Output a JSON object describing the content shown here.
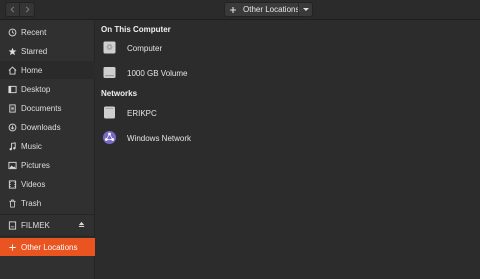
{
  "header": {
    "back_icon": "chevron-left-icon",
    "forward_icon": "chevron-right-icon",
    "path_label": "Other Locations",
    "path_icon": "plus-icon",
    "menu_icon": "caret-down-icon"
  },
  "sidebar": {
    "items": [
      {
        "label": "Recent",
        "icon": "clock-icon"
      },
      {
        "label": "Starred",
        "icon": "star-icon"
      },
      {
        "label": "Home",
        "icon": "home-icon"
      },
      {
        "label": "Desktop",
        "icon": "desktop-icon"
      },
      {
        "label": "Documents",
        "icon": "document-icon"
      },
      {
        "label": "Downloads",
        "icon": "download-icon"
      },
      {
        "label": "Music",
        "icon": "music-icon"
      },
      {
        "label": "Pictures",
        "icon": "picture-icon"
      },
      {
        "label": "Videos",
        "icon": "video-icon"
      },
      {
        "label": "Trash",
        "icon": "trash-icon"
      }
    ],
    "device": {
      "label": "FILMEK",
      "icon": "drive-icon",
      "eject_icon": "eject-icon"
    },
    "other_locations": {
      "label": "Other Locations",
      "icon": "plus-icon"
    },
    "accent_color": "#e95420"
  },
  "main": {
    "on_this_computer": {
      "title": "On This Computer",
      "items": [
        {
          "label": "Computer",
          "icon": "computer-drive-icon"
        },
        {
          "label": "1000 GB Volume",
          "icon": "volume-drive-icon"
        }
      ]
    },
    "networks": {
      "title": "Networks",
      "items": [
        {
          "label": "ERIKPC",
          "icon": "network-computer-icon"
        },
        {
          "label": "Windows Network",
          "icon": "windows-network-icon"
        }
      ]
    }
  }
}
